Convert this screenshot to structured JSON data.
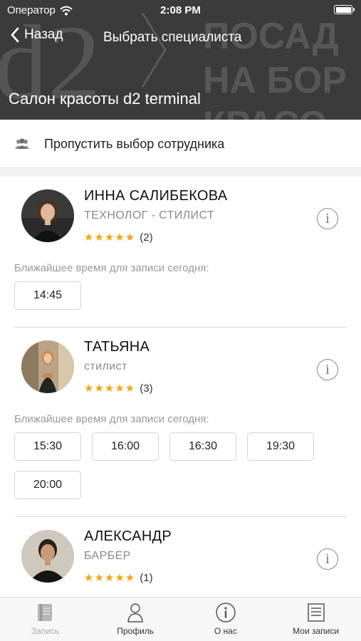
{
  "status_bar": {
    "carrier": "Оператор",
    "time": "2:08 PM"
  },
  "nav": {
    "back_label": "Назад",
    "title": "Выбрать специалиста"
  },
  "header": {
    "salon_title": "Салон красоты d2 terminal",
    "bg_logo_text": "d2",
    "bg_line_1": "ПОСАД",
    "bg_line_2": "НА БОР",
    "bg_line_3": "КРАСО"
  },
  "skip": {
    "label": "Пропустить выбор сотрудника",
    "icon": "group-icon"
  },
  "nearest_label": "Ближайшее время для записи сегодня:",
  "specialists": [
    {
      "name": "ИННА САЛИБЕКОВА",
      "role": "ТЕХНОЛОГ - СТИЛИСТ",
      "stars": "★★★★★",
      "rating_count": "(2)",
      "slots": [
        "14:45"
      ]
    },
    {
      "name": "ТАТЬЯНА",
      "role": "стилист",
      "stars": "★★★★★",
      "rating_count": "(3)",
      "slots": [
        "15:30",
        "16:00",
        "16:30",
        "19:30",
        "20:00"
      ]
    },
    {
      "name": "АЛЕКСАНДР",
      "role": "БАРБЕР",
      "stars": "★★★★★",
      "rating_count": "(1)",
      "slots": []
    }
  ],
  "tabbar": {
    "tabs": [
      {
        "label": "Запись",
        "icon": "book-icon",
        "disabled": true
      },
      {
        "label": "Профиль",
        "icon": "person-icon",
        "disabled": false
      },
      {
        "label": "О нас",
        "icon": "info-icon",
        "disabled": false
      },
      {
        "label": "Мои записи",
        "icon": "list-icon",
        "disabled": false
      }
    ]
  },
  "colors": {
    "accent_star": "#f2a60d",
    "header_bg": "#3a3a3a"
  }
}
